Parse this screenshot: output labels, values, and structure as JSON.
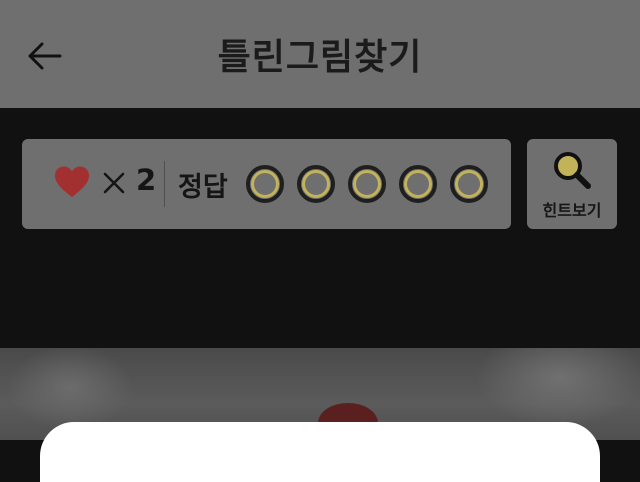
{
  "header": {
    "title": "틀린그림찾기",
    "back_icon": "arrow-left-icon"
  },
  "status": {
    "lives_icon": "heart-icon",
    "lives_color": "#c43535",
    "multiply_icon": "times-icon",
    "lives_count": "2",
    "answer_label": "정답",
    "answer_slots": [
      {
        "state": "empty"
      },
      {
        "state": "empty"
      },
      {
        "state": "empty"
      },
      {
        "state": "empty"
      },
      {
        "state": "empty"
      }
    ],
    "slot_color": "#c2b35a"
  },
  "hint": {
    "icon": "magnifier-icon",
    "label": "힌트보기"
  },
  "colors": {
    "header_bg": "#6f6f6f",
    "page_bg": "#111111",
    "sheet_bg": "#ffffff"
  }
}
